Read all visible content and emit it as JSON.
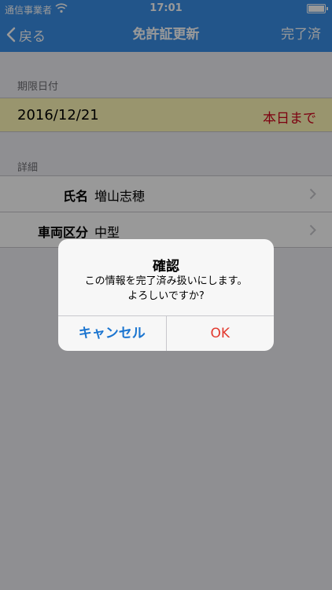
{
  "status_bar": {
    "carrier": "通信事業者",
    "time": "17:01",
    "icons": [
      "wifi-icon",
      "battery-icon"
    ]
  },
  "nav": {
    "back_label": "戻る",
    "title": "免許証更新",
    "done_label": "完了済"
  },
  "expiry": {
    "header": "期限日付",
    "date": "2016/12/21",
    "status": "本日まで"
  },
  "details": {
    "header": "詳細",
    "rows": [
      {
        "label": "氏名",
        "value": "増山志穂"
      },
      {
        "label": "車両区分",
        "value": "中型"
      }
    ]
  },
  "alert": {
    "title": "確認",
    "message_line1": "この情報を完了済み扱いにします。",
    "message_line2": "よろしいですか?",
    "cancel_label": "キャンセル",
    "ok_label": "OK"
  },
  "colors": {
    "nav_bg": "#3a8ee6",
    "expiry_bg": "#fff9b8",
    "status_red": "#d0021b",
    "cancel_blue": "#1b75d0",
    "ok_red": "#e2392e"
  }
}
